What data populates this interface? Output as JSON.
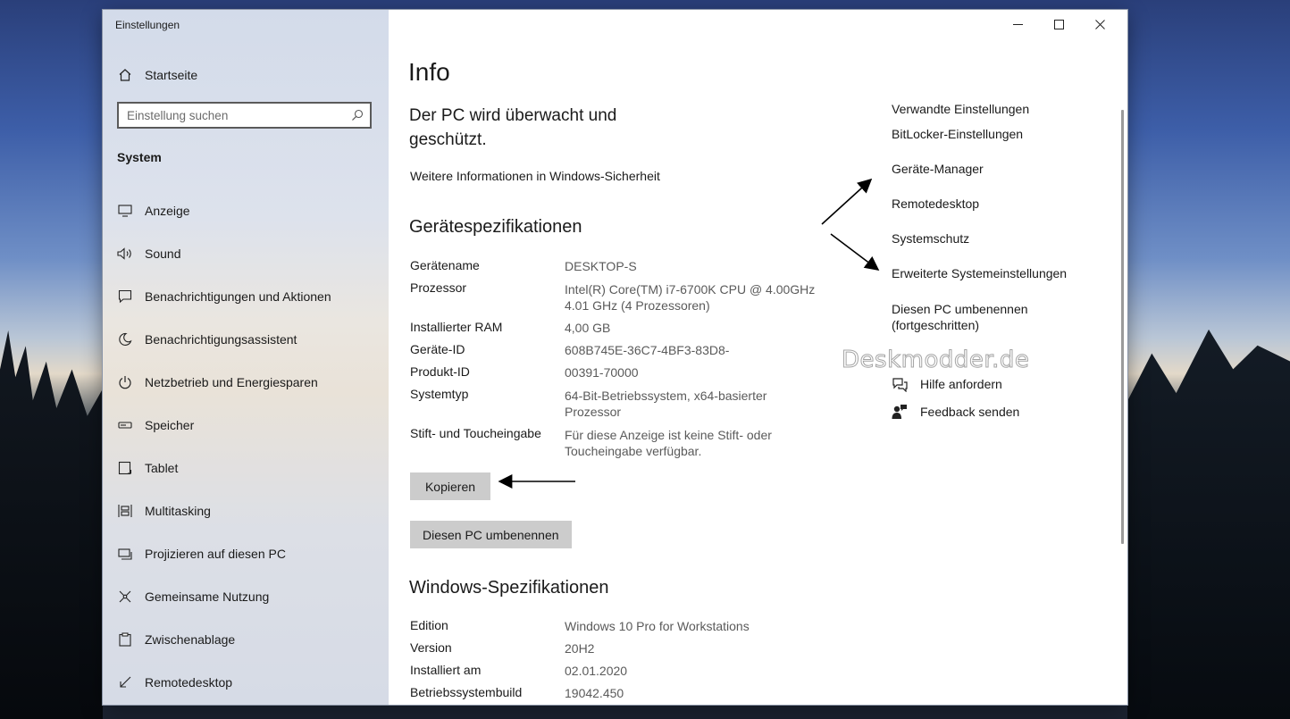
{
  "app_title": "Einstellungen",
  "home": {
    "label": "Startseite",
    "icon": "home-icon"
  },
  "search": {
    "placeholder": "Einstellung suchen",
    "icon": "search-icon"
  },
  "section_title": "System",
  "nav": [
    {
      "label": "Anzeige",
      "icon": "display-icon"
    },
    {
      "label": "Sound",
      "icon": "speaker-icon"
    },
    {
      "label": "Benachrichtigungen und Aktionen",
      "icon": "notification-icon"
    },
    {
      "label": "Benachrichtigungsassistent",
      "icon": "moon-icon"
    },
    {
      "label": "Netzbetrieb und Energiesparen",
      "icon": "power-icon"
    },
    {
      "label": "Speicher",
      "icon": "storage-icon"
    },
    {
      "label": "Tablet",
      "icon": "tablet-icon"
    },
    {
      "label": "Multitasking",
      "icon": "multitasking-icon"
    },
    {
      "label": "Projizieren auf diesen PC",
      "icon": "project-icon"
    },
    {
      "label": "Gemeinsame Nutzung",
      "icon": "share-icon"
    },
    {
      "label": "Zwischenablage",
      "icon": "clipboard-icon"
    },
    {
      "label": "Remotedesktop",
      "icon": "remote-icon"
    }
  ],
  "page_title": "Info",
  "protection": {
    "heading": "Der PC wird überwacht und geschützt.",
    "link": "Weitere Informationen in Windows-Sicherheit"
  },
  "device_specs": {
    "heading": "Gerätespezifikationen",
    "rows": [
      {
        "key": "Gerätename",
        "value": "DESKTOP-S"
      },
      {
        "key": "Prozessor",
        "value": "Intel(R) Core(TM) i7-6700K CPU @ 4.00GHz 4.01 GHz (4 Prozessoren)"
      },
      {
        "key": "Installierter RAM",
        "value": "4,00 GB"
      },
      {
        "key": "Geräte-ID",
        "value": "608B745E-36C7-4BF3-83D8-"
      },
      {
        "key": "Produkt-ID",
        "value": "00391-70000"
      },
      {
        "key": "Systemtyp",
        "value": "64-Bit-Betriebssystem, x64-basierter Prozessor"
      },
      {
        "key": "Stift- und Toucheingabe",
        "value": "Für diese Anzeige ist keine Stift- oder Toucheingabe verfügbar."
      }
    ]
  },
  "buttons": {
    "copy": "Kopieren",
    "rename": "Diesen PC umbenennen"
  },
  "windows_specs": {
    "heading": "Windows-Spezifikationen",
    "rows": [
      {
        "key": "Edition",
        "value": "Windows 10 Pro for Workstations"
      },
      {
        "key": "Version",
        "value": "20H2"
      },
      {
        "key": "Installiert am",
        "value": "02.01.2020"
      },
      {
        "key": "Betriebssystembuild",
        "value": "19042.450"
      }
    ]
  },
  "related": {
    "title": "Verwandte Einstellungen",
    "links": [
      "BitLocker-Einstellungen",
      "Geräte-Manager",
      "Remotedesktop",
      "Systemschutz",
      "Erweiterte Systemeinstellungen",
      "Diesen PC umbenennen (fortgeschritten)"
    ]
  },
  "help": [
    {
      "label": "Hilfe anfordern",
      "icon": "help-chat-icon"
    },
    {
      "label": "Feedback senden",
      "icon": "feedback-icon"
    }
  ],
  "watermark": "Deskmodder.de",
  "window_controls": [
    "minimize-icon",
    "maximize-icon",
    "close-icon"
  ],
  "colors": {
    "sidebar_bg": "#d8deea",
    "button_bg": "#cccccc",
    "text": "#1a1a1a",
    "value_text": "#5a5a5a"
  }
}
